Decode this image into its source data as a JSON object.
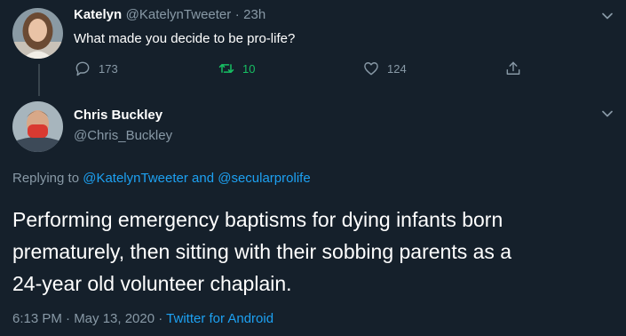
{
  "parent_tweet": {
    "author_name": "Katelyn",
    "author_handle": "@KatelynTweeter",
    "separator": "·",
    "time_ago": "23h",
    "text": "What made you decide to be pro-life?",
    "replies": "173",
    "retweets": "10",
    "likes": "124"
  },
  "main_tweet": {
    "author_name": "Chris Buckley",
    "author_handle": "@Chris_Buckley",
    "replying_prefix": "Replying to",
    "replying_user_1": "@KatelynTweeter",
    "replying_and": "and",
    "replying_user_2": "@secularprolife",
    "text_line_1": "Performing emergency baptisms for dying infants born",
    "text_line_2": "prematurely, then sitting with their sobbing parents as a",
    "text_line_3": "24-year old volunteer chaplain.",
    "timestamp": "6:13 PM · May 13, 2020 ·",
    "source": "Twitter for Android"
  },
  "colors": {
    "background": "#15202b",
    "muted": "#8899a6",
    "link": "#1da1f2",
    "retweet_active": "#17bf63"
  },
  "icons": [
    "chevron-down-icon",
    "reply-icon",
    "retweet-icon",
    "like-icon",
    "share-icon"
  ]
}
